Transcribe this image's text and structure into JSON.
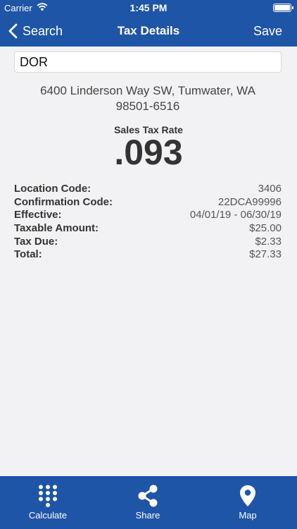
{
  "status": {
    "carrier": "Carrier",
    "time": "1:45 PM"
  },
  "nav": {
    "back_label": "Search",
    "title": "Tax Details",
    "save_label": "Save"
  },
  "name_field": {
    "value": "DOR"
  },
  "address": {
    "line1": "6400 Linderson Way SW, Tumwater, WA",
    "line2": "98501-6516"
  },
  "rate": {
    "label": "Sales Tax Rate",
    "value": ".093"
  },
  "details": [
    {
      "label": "Location Code:",
      "value": "3406"
    },
    {
      "label": "Confirmation Code:",
      "value": "22DCA99996"
    },
    {
      "label": "Effective:",
      "value": "04/01/19 - 06/30/19"
    },
    {
      "label": "Taxable Amount:",
      "value": "$25.00"
    },
    {
      "label": "Tax Due:",
      "value": "$2.33"
    },
    {
      "label": "Total:",
      "value": "$27.33"
    }
  ],
  "tabs": [
    {
      "label": "Calculate",
      "icon": "keypad-icon"
    },
    {
      "label": "Share",
      "icon": "share-icon"
    },
    {
      "label": "Map",
      "icon": "map-pin-icon"
    }
  ],
  "colors": {
    "brand": "#1f55a6",
    "background": "#f2f2f4"
  }
}
